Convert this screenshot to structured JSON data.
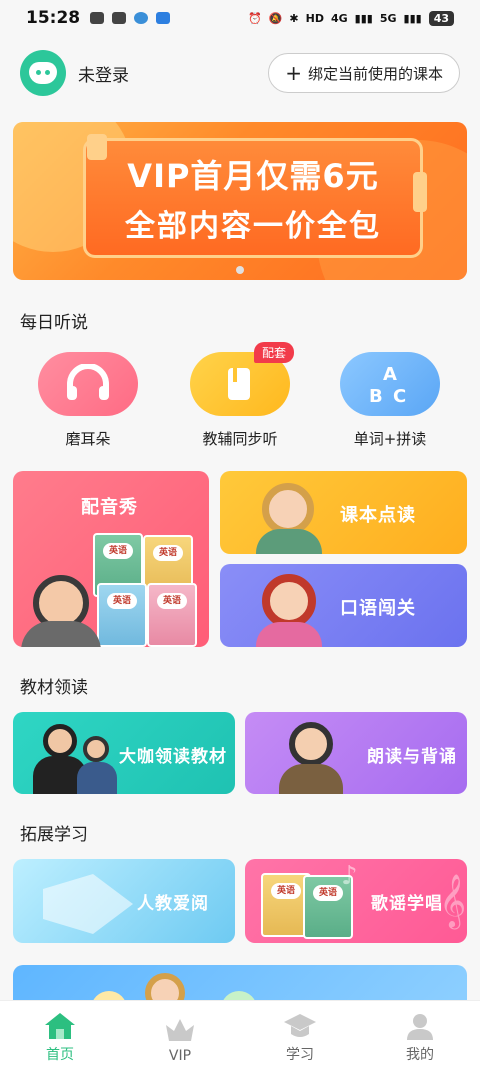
{
  "status_bar": {
    "time": "15:28",
    "network": "4G",
    "network2": "5G",
    "hd": "HD",
    "battery": "43"
  },
  "header": {
    "login_status": "未登录",
    "bind_button": "绑定当前使用的课本"
  },
  "banner": {
    "line1": "VIP首月仅需6元",
    "line2": "全部内容一价全包"
  },
  "daily": {
    "title": "每日听说",
    "items": [
      {
        "label": "磨耳朵"
      },
      {
        "label": "教辅同步听",
        "badge": "配套"
      },
      {
        "label": "单词+拼读"
      }
    ]
  },
  "cards": {
    "dubbing": "配音秀",
    "textbook_read": "课本点读",
    "oral": "口语闯关",
    "book_label": "英语"
  },
  "textbook": {
    "title": "教材领读",
    "item1": "大咖领读教材",
    "item2": "朗读与背诵"
  },
  "expand": {
    "title": "拓展学习",
    "item1": "人教爱阅",
    "item2": "歌谣学唱"
  },
  "tabbar": {
    "items": [
      {
        "label": "首页",
        "active": true
      },
      {
        "label": "VIP",
        "active": false
      },
      {
        "label": "学习",
        "active": false
      },
      {
        "label": "我的",
        "active": false
      }
    ]
  },
  "colors": {
    "accent": "#2cbf80",
    "banner": "#ff7a2a",
    "badge": "#f23b4a"
  }
}
